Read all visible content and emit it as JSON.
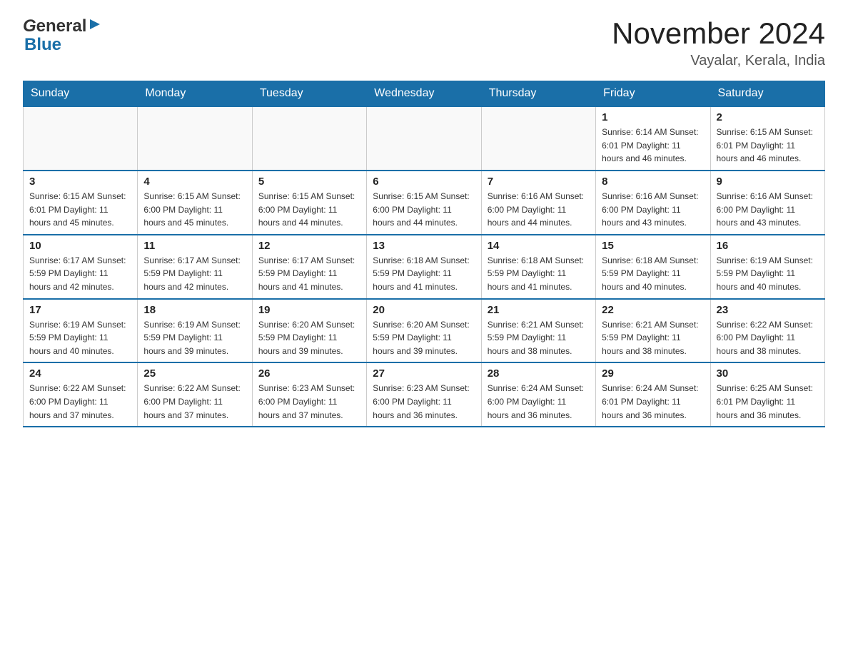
{
  "header": {
    "logo_general": "General",
    "logo_blue": "Blue",
    "month_title": "November 2024",
    "location": "Vayalar, Kerala, India"
  },
  "weekdays": [
    "Sunday",
    "Monday",
    "Tuesday",
    "Wednesday",
    "Thursday",
    "Friday",
    "Saturday"
  ],
  "weeks": [
    [
      {
        "day": "",
        "info": ""
      },
      {
        "day": "",
        "info": ""
      },
      {
        "day": "",
        "info": ""
      },
      {
        "day": "",
        "info": ""
      },
      {
        "day": "",
        "info": ""
      },
      {
        "day": "1",
        "info": "Sunrise: 6:14 AM\nSunset: 6:01 PM\nDaylight: 11 hours and 46 minutes."
      },
      {
        "day": "2",
        "info": "Sunrise: 6:15 AM\nSunset: 6:01 PM\nDaylight: 11 hours and 46 minutes."
      }
    ],
    [
      {
        "day": "3",
        "info": "Sunrise: 6:15 AM\nSunset: 6:01 PM\nDaylight: 11 hours and 45 minutes."
      },
      {
        "day": "4",
        "info": "Sunrise: 6:15 AM\nSunset: 6:00 PM\nDaylight: 11 hours and 45 minutes."
      },
      {
        "day": "5",
        "info": "Sunrise: 6:15 AM\nSunset: 6:00 PM\nDaylight: 11 hours and 44 minutes."
      },
      {
        "day": "6",
        "info": "Sunrise: 6:15 AM\nSunset: 6:00 PM\nDaylight: 11 hours and 44 minutes."
      },
      {
        "day": "7",
        "info": "Sunrise: 6:16 AM\nSunset: 6:00 PM\nDaylight: 11 hours and 44 minutes."
      },
      {
        "day": "8",
        "info": "Sunrise: 6:16 AM\nSunset: 6:00 PM\nDaylight: 11 hours and 43 minutes."
      },
      {
        "day": "9",
        "info": "Sunrise: 6:16 AM\nSunset: 6:00 PM\nDaylight: 11 hours and 43 minutes."
      }
    ],
    [
      {
        "day": "10",
        "info": "Sunrise: 6:17 AM\nSunset: 5:59 PM\nDaylight: 11 hours and 42 minutes."
      },
      {
        "day": "11",
        "info": "Sunrise: 6:17 AM\nSunset: 5:59 PM\nDaylight: 11 hours and 42 minutes."
      },
      {
        "day": "12",
        "info": "Sunrise: 6:17 AM\nSunset: 5:59 PM\nDaylight: 11 hours and 41 minutes."
      },
      {
        "day": "13",
        "info": "Sunrise: 6:18 AM\nSunset: 5:59 PM\nDaylight: 11 hours and 41 minutes."
      },
      {
        "day": "14",
        "info": "Sunrise: 6:18 AM\nSunset: 5:59 PM\nDaylight: 11 hours and 41 minutes."
      },
      {
        "day": "15",
        "info": "Sunrise: 6:18 AM\nSunset: 5:59 PM\nDaylight: 11 hours and 40 minutes."
      },
      {
        "day": "16",
        "info": "Sunrise: 6:19 AM\nSunset: 5:59 PM\nDaylight: 11 hours and 40 minutes."
      }
    ],
    [
      {
        "day": "17",
        "info": "Sunrise: 6:19 AM\nSunset: 5:59 PM\nDaylight: 11 hours and 40 minutes."
      },
      {
        "day": "18",
        "info": "Sunrise: 6:19 AM\nSunset: 5:59 PM\nDaylight: 11 hours and 39 minutes."
      },
      {
        "day": "19",
        "info": "Sunrise: 6:20 AM\nSunset: 5:59 PM\nDaylight: 11 hours and 39 minutes."
      },
      {
        "day": "20",
        "info": "Sunrise: 6:20 AM\nSunset: 5:59 PM\nDaylight: 11 hours and 39 minutes."
      },
      {
        "day": "21",
        "info": "Sunrise: 6:21 AM\nSunset: 5:59 PM\nDaylight: 11 hours and 38 minutes."
      },
      {
        "day": "22",
        "info": "Sunrise: 6:21 AM\nSunset: 5:59 PM\nDaylight: 11 hours and 38 minutes."
      },
      {
        "day": "23",
        "info": "Sunrise: 6:22 AM\nSunset: 6:00 PM\nDaylight: 11 hours and 38 minutes."
      }
    ],
    [
      {
        "day": "24",
        "info": "Sunrise: 6:22 AM\nSunset: 6:00 PM\nDaylight: 11 hours and 37 minutes."
      },
      {
        "day": "25",
        "info": "Sunrise: 6:22 AM\nSunset: 6:00 PM\nDaylight: 11 hours and 37 minutes."
      },
      {
        "day": "26",
        "info": "Sunrise: 6:23 AM\nSunset: 6:00 PM\nDaylight: 11 hours and 37 minutes."
      },
      {
        "day": "27",
        "info": "Sunrise: 6:23 AM\nSunset: 6:00 PM\nDaylight: 11 hours and 36 minutes."
      },
      {
        "day": "28",
        "info": "Sunrise: 6:24 AM\nSunset: 6:00 PM\nDaylight: 11 hours and 36 minutes."
      },
      {
        "day": "29",
        "info": "Sunrise: 6:24 AM\nSunset: 6:01 PM\nDaylight: 11 hours and 36 minutes."
      },
      {
        "day": "30",
        "info": "Sunrise: 6:25 AM\nSunset: 6:01 PM\nDaylight: 11 hours and 36 minutes."
      }
    ]
  ]
}
